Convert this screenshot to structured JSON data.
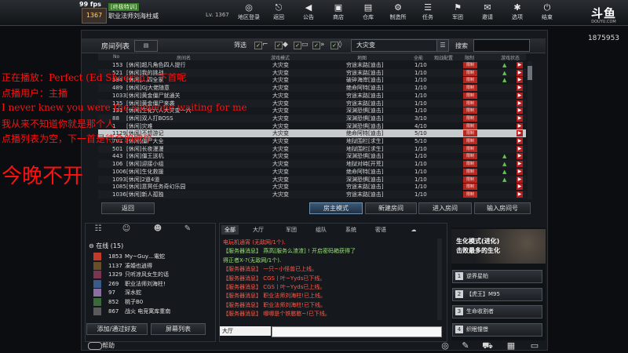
{
  "topbar": {
    "fps": "99 fps",
    "club_tag": "[终极特训]",
    "rank": "1367",
    "player_name": "职业法师刘海柱威",
    "player_level": "Lv. 1367",
    "nav": [
      {
        "label": "地区登录",
        "icon": "globe-icon",
        "glyph": "◎"
      },
      {
        "label": "返回",
        "icon": "back-icon",
        "glyph": "⎋"
      },
      {
        "label": "公告",
        "icon": "speaker-icon",
        "glyph": "◀"
      },
      {
        "label": "商店",
        "icon": "shop-icon",
        "glyph": "▣"
      },
      {
        "label": "仓库",
        "icon": "warehouse-icon",
        "glyph": "▤"
      },
      {
        "label": "制造所",
        "icon": "craft-icon",
        "glyph": "⚙"
      },
      {
        "label": "任务",
        "icon": "task-icon",
        "glyph": "☰"
      },
      {
        "label": "军团",
        "icon": "clan-icon",
        "glyph": "⚑"
      },
      {
        "label": "邀请",
        "icon": "invite-icon",
        "glyph": "✉"
      },
      {
        "label": "选项",
        "icon": "options-icon",
        "glyph": "✱"
      },
      {
        "label": "结束",
        "icon": "exit-icon",
        "glyph": "⏻"
      }
    ]
  },
  "brand": {
    "logo": "斗鱼",
    "sub": "DOUYU.COM",
    "viewers": "1875953"
  },
  "room": {
    "title": "房间列表",
    "filter_label": "筛选",
    "mode_filter": "大灾变",
    "search_label": "搜索",
    "columns": [
      "No",
      "房间名",
      "游戏模式",
      "地图",
      "全能",
      "观战配置",
      "限制",
      "游戏状态"
    ],
    "rows": [
      {
        "no": "153",
        "name": "[休闲]超凡角色四人提行",
        "mode": "大灾变",
        "map": "穷途末路[迪击]",
        "count": "1/10",
        "state": "▶"
      },
      {
        "no": "521",
        "name": "[休闲]我的挑战",
        "mode": "大灾变",
        "map": "穷途末路[迪击]",
        "count": "1/10",
        "state": "▶"
      },
      {
        "no": "584",
        "name": "[休闲]…四全家",
        "mode": "大灾变",
        "map": "破碎海岸[迪击]",
        "count": "1/10",
        "state": "▶"
      },
      {
        "no": "489",
        "name": "[休闲]GJ大佬随意",
        "mode": "大灾变",
        "map": "绝命阿特[迪击]",
        "count": "1/10",
        "state": "▶"
      },
      {
        "no": "1033",
        "name": "[休闲]黄金僵尸就通关",
        "mode": "大灾变",
        "map": "穷途末路[迪击]",
        "count": "1/10",
        "state": "▶"
      },
      {
        "no": "135",
        "name": "[休闲]黄金僵尸来袭",
        "mode": "大灾变",
        "map": "穷途末路[迪击]",
        "count": "1/10",
        "state": "▶"
      },
      {
        "no": "131",
        "name": "[休闲]生化六人大灾变一六",
        "mode": "大灾变",
        "map": "深渊恐惧[迪击]",
        "count": "1/10",
        "state": "▶"
      },
      {
        "no": "88",
        "name": "[休闲]双人打BOSS",
        "mode": "大灾变",
        "map": "深渊恐惧[迪击]",
        "count": "3/10",
        "state": "▶"
      },
      {
        "no": "1",
        "name": "[休闲]灾难",
        "mode": "大灾变",
        "map": "深渊恐惧[迪击]",
        "count": "4/10",
        "state": "▶"
      },
      {
        "no": "1129",
        "name": "[休闲]不想游记",
        "mode": "大灾变",
        "map": "绝命阿特[迪击]",
        "count": "5/10",
        "state": "▶"
      },
      {
        "no": "701",
        "name": "[休闲]僵尸大全",
        "mode": "大灾变",
        "map": "地狱围栏[求生]",
        "count": "5/10",
        "state": "▶"
      },
      {
        "no": "501",
        "name": "[休闲]长夜漫漫",
        "mode": "大灾变",
        "map": "地狱围栏[求生]",
        "count": "1/10",
        "state": "▶"
      },
      {
        "no": "443",
        "name": "[休闲]僵王送机",
        "mode": "大灾变",
        "map": "深渊恐惧[迪击]",
        "count": "1/10",
        "state": "▶"
      },
      {
        "no": "106",
        "name": "[休闲]迎接小组",
        "mode": "大灾变",
        "map": "地狱对峙[开荒]",
        "count": "1/10",
        "state": "▶"
      },
      {
        "no": "1006",
        "name": "[休闲]生化救援",
        "mode": "大灾变",
        "map": "绝命阿特[迪击]",
        "count": "1/10",
        "state": "▶"
      },
      {
        "no": "1093",
        "name": "[休闲]2道4道",
        "mode": "大灾变",
        "map": "深渊恐惧[迪击]",
        "count": "1/10",
        "state": "▶"
      },
      {
        "no": "1085",
        "name": "[休闲]意冥任务奇幻乐园",
        "mode": "大灾变",
        "map": "穷途末路[迪击]",
        "count": "1/10",
        "state": "▶"
      },
      {
        "no": "1036",
        "name": "[休闲]新人孤独",
        "mode": "大灾变",
        "map": "穷途末路[迪击]",
        "count": "1/10",
        "state": "▶"
      }
    ],
    "limit_tag": "限制",
    "buttons": {
      "back": "返回",
      "host": "房主模式",
      "new": "新建房间",
      "enter": "进入房间",
      "enter_no": "输入房间号"
    }
  },
  "friends": {
    "online_header": "在线 (15)",
    "list": [
      {
        "level": "1853",
        "name": "My~Guy…電蛇",
        "color": "#c23b2a"
      },
      {
        "level": "1137",
        "name": "凑婚也逍得",
        "color": "#6a4d2a"
      },
      {
        "level": "1329",
        "name": "只听凉风女生的话",
        "color": "#7a3550"
      },
      {
        "level": "269",
        "name": "职业法师刘海柱!",
        "color": "#3a5a8a"
      },
      {
        "level": "97",
        "name": "深水蛇",
        "color": "#8a6fa0"
      },
      {
        "level": "852",
        "name": "桃子B0",
        "color": "#3a6a3a"
      },
      {
        "level": "867",
        "name": "战火 电竞寓库重南",
        "color": "#5a5a5a"
      }
    ],
    "add_button": "添加/通过好友",
    "playlist_button": "屏幕列表",
    "help_label": "帮助"
  },
  "chat": {
    "tabs": [
      "全部",
      "大厅",
      "军团",
      "组队",
      "系统",
      "密语"
    ],
    "lines": [
      {
        "text": "电玩机通宵 (无敌网/1个).",
        "cls": "sys"
      },
      {
        "text": "【服务器消息】 燕高[服务么渣渣] ! 开启密码箱获得了",
        "cls": "sysg"
      },
      {
        "text": "得正者X-?(无敌网/1个).",
        "cls": "sysg"
      },
      {
        "text": "【服务器消息】 一只~小怪兽已上线。",
        "cls": "sys"
      },
      {
        "text": "【服务器消息】 CGS丨叶~Yyds已下线。",
        "cls": "sys"
      },
      {
        "text": "【服务器消息】 CGS丨叶~Yyds已上线。",
        "cls": "sys"
      },
      {
        "text": "【服务器消息】 职业法师刘海柱!已上线。",
        "cls": "sys"
      },
      {
        "text": "【服务器消息】 职业法师刘海柱!已下线。",
        "cls": "sys"
      },
      {
        "text": "【服务器消息】 哪哪是个铁憨憨~!已下线。",
        "cls": "sys"
      }
    ],
    "channel": "大厅"
  },
  "right": {
    "feature_title": "生化模式(进化)",
    "feature_sub": "击败最多的生化",
    "quick": [
      {
        "num": "1",
        "label": "逆界星帕"
      },
      {
        "num": "2",
        "label": "【虎王】M95"
      },
      {
        "num": "3",
        "label": "生命收割者"
      },
      {
        "num": "4",
        "label": "织眠憧憬"
      }
    ]
  },
  "overlay": {
    "line1": "正在播放：Perfect (Ed Sheeran) - 下首呢",
    "line2": "点播用户：主播",
    "line3": "I never knew you were the someone waiting for me",
    "line4": "我从来不知道你就是那个人",
    "line5": "点播列表为空，下一首是待会的歌单",
    "line6": "今晚不开"
  }
}
